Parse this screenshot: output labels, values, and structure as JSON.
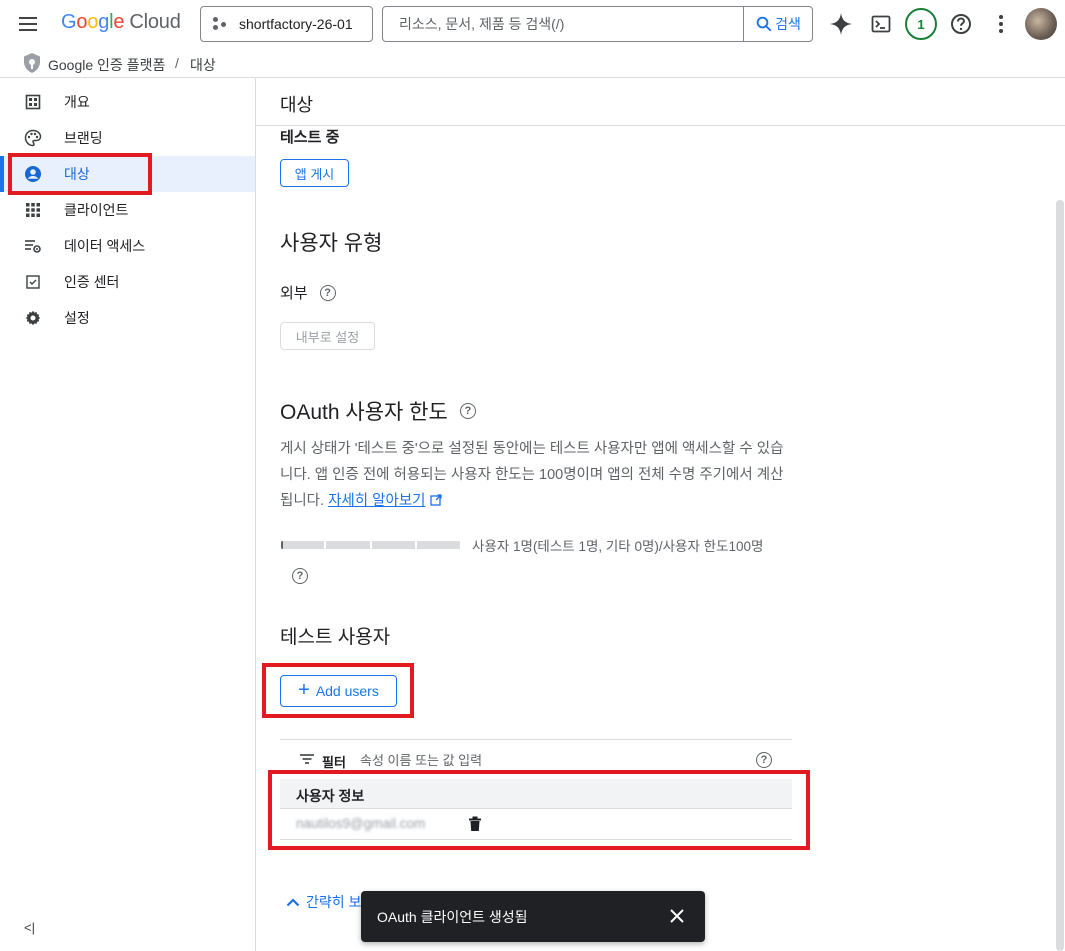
{
  "header": {
    "logo_letters": [
      "G",
      "o",
      "o",
      "g",
      "l",
      "e"
    ],
    "logo_product": "Cloud",
    "project_name": "shortfactory-26-01",
    "search_placeholder": "리소스, 문서, 제품 등 검색(/)",
    "search_button": "검색",
    "notification_count": "1"
  },
  "breadcrumb": {
    "product": "Google 인증 플랫폼",
    "separator": "/",
    "current": "대상"
  },
  "sidebar": {
    "items": [
      {
        "label": "개요",
        "icon": "dashboard-icon"
      },
      {
        "label": "브랜딩",
        "icon": "palette-icon"
      },
      {
        "label": "대상",
        "icon": "account-circle-icon",
        "active": true
      },
      {
        "label": "클라이언트",
        "icon": "apps-grid-icon"
      },
      {
        "label": "데이터 액세스",
        "icon": "data-settings-icon"
      },
      {
        "label": "인증 센터",
        "icon": "verified-box-icon"
      },
      {
        "label": "설정",
        "icon": "gear-icon"
      }
    ],
    "collapse_label": "<|"
  },
  "main": {
    "title": "대상",
    "publishing_status": "테스트 중",
    "publish_button": "앱 게시",
    "user_type_heading": "사용자 유형",
    "user_type_value": "외부",
    "make_internal_button": "내부로 설정",
    "oauth_limit_heading": "OAuth 사용자 한도",
    "oauth_limit_description": "게시 상태가 '테스트 중'으로 설정된 동안에는 테스트 사용자만 앱에 액세스할 수 있습니다. 앱 인증 전에 허용되는 사용자 한도는 100명이며 앱의 전체 수명 주기에서 계산됩니다.",
    "learn_more_link": "자세히 알아보기",
    "quota_used": 1,
    "quota_limit": 100,
    "quota_text": "사용자 1명(테스트 1명, 기타 0명)/사용자 한도100명",
    "test_users_heading": "테스트 사용자",
    "add_users_button": "Add users",
    "filter_label": "필터",
    "filter_placeholder": "속성 이름 또는 값 입력",
    "table_header": "사용자 정보",
    "users": [
      {
        "email": "nautilos9@gmail.com"
      }
    ],
    "collapse_link": "간략히 보기"
  },
  "snackbar": {
    "message": "OAuth 클라이언트 생성됨"
  },
  "colors": {
    "accent": "#1a73e8",
    "highlight": "#e21b23",
    "active_nav_bg": "#e8f0fe"
  }
}
